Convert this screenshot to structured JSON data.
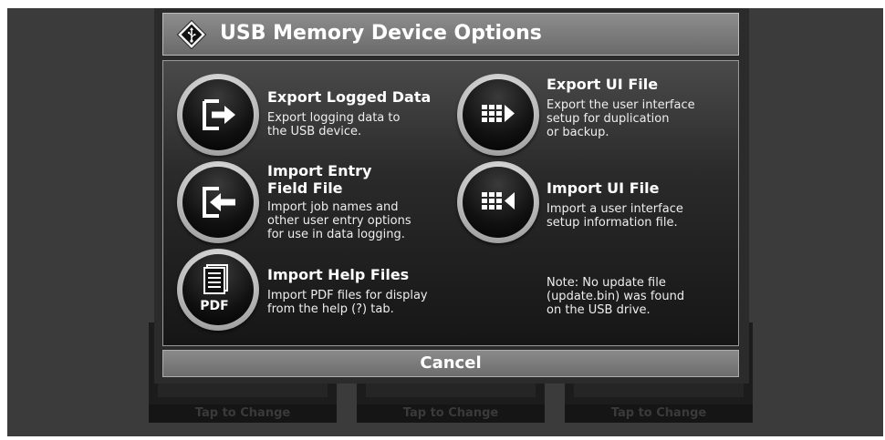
{
  "dialog": {
    "title": "USB Memory Device Options",
    "title_icon": "usb-icon"
  },
  "options": {
    "export_logged": {
      "title": "Export Logged Data",
      "description": "Export logging data to\nthe USB device.",
      "icon": "export-arrow-icon"
    },
    "import_entry": {
      "title": "Import Entry\nField File",
      "description": "Import job names and\nother user entry options\nfor use in data logging.",
      "icon": "import-arrow-icon"
    },
    "import_help": {
      "title": "Import Help Files",
      "description": "Import PDF files for display\nfrom the help (?) tab.",
      "icon": "pdf-icon",
      "icon_text": "PDF"
    },
    "export_ui": {
      "title": "Export UI File",
      "description": "Export the user interface\nsetup for duplication\nor backup.",
      "icon": "grid-export-icon"
    },
    "import_ui": {
      "title": "Import UI File",
      "description": "Import a user interface\nsetup information file.",
      "icon": "grid-import-icon"
    }
  },
  "note": "Note: No update file\n(update.bin) was found\non the USB drive.",
  "cancel_label": "Cancel",
  "background": {
    "tap_labels": [
      "Tap to Change",
      "Tap to Change",
      "Tap to Change"
    ]
  }
}
